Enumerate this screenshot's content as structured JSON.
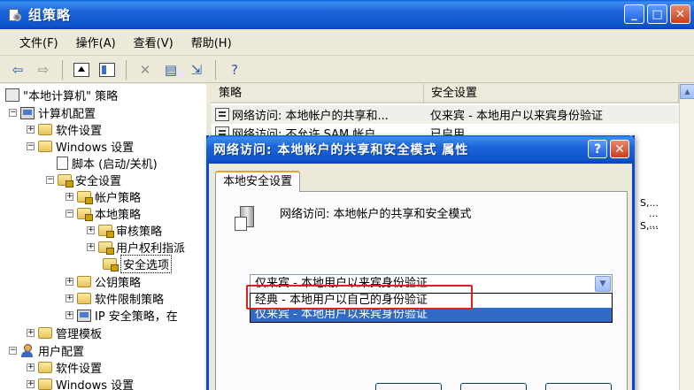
{
  "window": {
    "title": "组策略",
    "minimize": "_",
    "maximize": "□",
    "close": "✕"
  },
  "menu": [
    "文件(F)",
    "操作(A)",
    "查看(V)",
    "帮助(H)"
  ],
  "toolbar": {
    "icons": [
      "back-arrow-icon",
      "forward-arrow-icon",
      "up-folder-icon",
      "show-pane-icon",
      "delete-icon",
      "properties-icon",
      "export-icon",
      "help-icon"
    ]
  },
  "tree": {
    "root": "\"本地计算机\" 策略",
    "computer_config": "计算机配置",
    "software_settings": "软件设置",
    "windows_settings": "Windows 设置",
    "scripts": "脚本 (启动/关机)",
    "security_settings": "安全设置",
    "account_policies": "帐户策略",
    "local_policies": "本地策略",
    "audit_policy": "审核策略",
    "user_rights": "用户权利指派",
    "security_options": "安全选项",
    "public_key": "公钥策略",
    "software_restriction": "软件限制策略",
    "ip_security": "IP 安全策略，在",
    "admin_templates": "管理模板",
    "user_config": "用户配置",
    "user_software_settings": "软件设置",
    "user_windows_settings": "Windows 设置"
  },
  "list": {
    "columns": [
      "策略",
      "安全设置"
    ],
    "rows": [
      {
        "policy": "网络访问: 本地帐户的共享和...",
        "setting": "仅来宾 - 本地用户以来宾身份验证"
      },
      {
        "policy": "网络访问: 不允许 SAM 帐户...",
        "setting": "已启用"
      }
    ],
    "fragments": [
      "S,...",
      "...",
      "...",
      "S,..."
    ]
  },
  "dialog": {
    "title": "网络访问: 本地帐户的共享和安全模式 属性",
    "help": "?",
    "close": "✕",
    "tab": "本地安全设置",
    "policy_label": "网络访问: 本地帐户的共享和安全模式",
    "combo_value": "仅来宾 - 本地用户以来宾身份验证",
    "options": [
      "经典 - 本地用户以自己的身份验证",
      "仅来宾 - 本地用户以来宾身份验证"
    ],
    "colors": {
      "highlight": "#e0201e",
      "selection": "#316ac5"
    }
  }
}
